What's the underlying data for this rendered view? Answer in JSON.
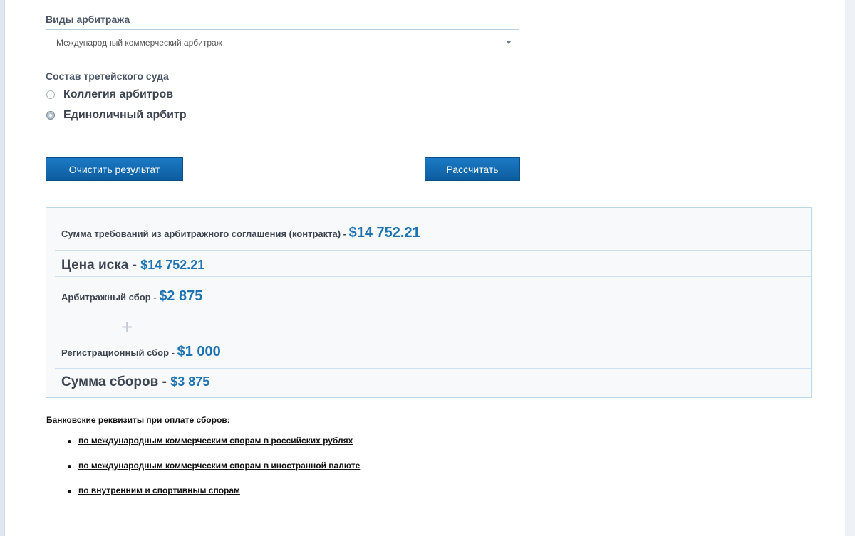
{
  "arbitration": {
    "label": "Виды арбитража",
    "selected": "Международный коммерческий арбитраж"
  },
  "tribunal": {
    "label": "Состав третейского суда",
    "options": [
      {
        "label": "Коллегия арбитров",
        "checked": false
      },
      {
        "label": "Единоличный арбитр",
        "checked": true
      }
    ]
  },
  "buttons": {
    "clear": "Очистить результат",
    "calculate": "Рассчитать"
  },
  "results": {
    "claim_sum_label": "Сумма требований из арбитражного соглашения (контракта) - ",
    "claim_sum_value": "$14 752.21",
    "claim_price_label": "Цена иска - ",
    "claim_price_value": "$14 752.21",
    "arb_fee_label": "Арбитражный сбор - ",
    "arb_fee_value": "$2 875",
    "plus": "+",
    "reg_fee_label": "Регистрационный сбор - ",
    "reg_fee_value": "$1 000",
    "total_label": "Сумма сборов - ",
    "total_value": "$3 875"
  },
  "bank": {
    "title": "Банковские реквизиты при оплате сборов:",
    "links": [
      "по международным коммерческим спорам в российских рублях",
      "по международным коммерческим спорам в иностранной валюте",
      "по внутренним и спортивным спорам"
    ]
  },
  "colors": {
    "accent": "#1e73b1",
    "button": "#0d5d9e"
  }
}
